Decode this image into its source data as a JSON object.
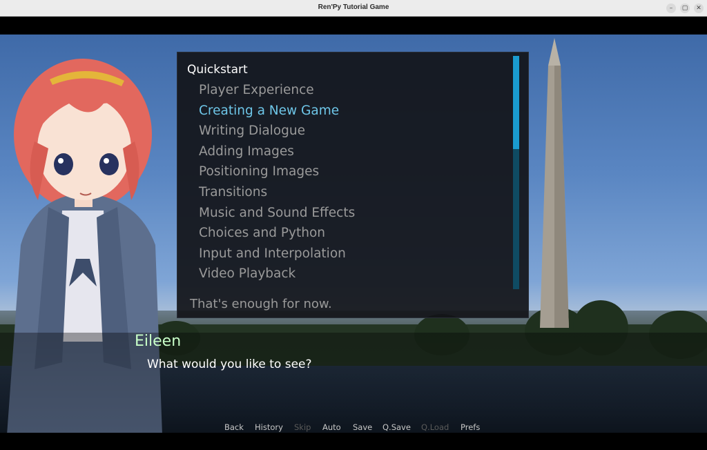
{
  "window": {
    "title": "Ren'Py Tutorial Game",
    "buttons": [
      "–",
      "▢",
      "✕"
    ]
  },
  "menu": {
    "section": "Quickstart",
    "items": [
      {
        "label": "Player Experience",
        "active": false
      },
      {
        "label": "Creating a New Game",
        "active": true
      },
      {
        "label": "Writing Dialogue",
        "active": false
      },
      {
        "label": "Adding Images",
        "active": false
      },
      {
        "label": "Positioning Images",
        "active": false
      },
      {
        "label": "Transitions",
        "active": false
      },
      {
        "label": "Music and Sound Effects",
        "active": false
      },
      {
        "label": "Choices and Python",
        "active": false
      },
      {
        "label": "Input and Interpolation",
        "active": false
      },
      {
        "label": "Video Playback",
        "active": false
      }
    ],
    "enough": "That's enough for now.",
    "scroll_fraction": 0.4
  },
  "dialogue": {
    "speaker": "Eileen",
    "text": "What would you like to see?"
  },
  "quickmenu": [
    {
      "label": "Back",
      "enabled": true
    },
    {
      "label": "History",
      "enabled": true
    },
    {
      "label": "Skip",
      "enabled": false
    },
    {
      "label": "Auto",
      "enabled": true
    },
    {
      "label": "Save",
      "enabled": true
    },
    {
      "label": "Q.Save",
      "enabled": true
    },
    {
      "label": "Q.Load",
      "enabled": false
    },
    {
      "label": "Prefs",
      "enabled": true
    }
  ],
  "colors": {
    "accent": "#1a9bcf",
    "active_item": "#6ec6e8",
    "speaker": "#c8ffc8"
  }
}
